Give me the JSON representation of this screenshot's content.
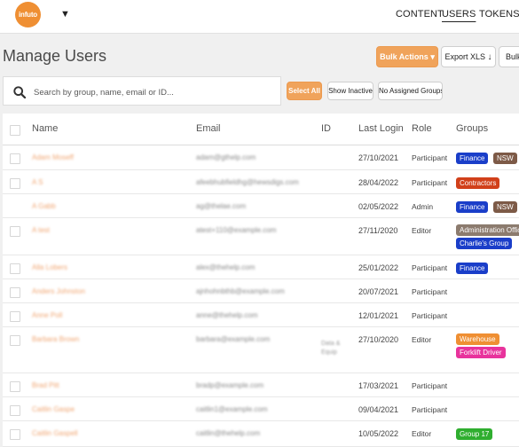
{
  "logo": {
    "text": "infuto"
  },
  "nav": {
    "content": "CONTENT",
    "users": "USERS",
    "tokens": "TOKENS"
  },
  "page": {
    "title": "Manage Users"
  },
  "toolbar": {
    "bulk_actions": "Bulk Actions ▾",
    "export_xls": "Export XLS",
    "bulk_cut": "Bulk"
  },
  "search": {
    "placeholder": "Search by group, name, email or ID..."
  },
  "filters": {
    "select_all": "Select All",
    "show_inactive": "Show Inactive",
    "no_assigned_groups": "No Assigned Groups"
  },
  "table": {
    "headers": {
      "name": "Name",
      "email": "Email",
      "id": "ID",
      "last_login": "Last Login",
      "role": "Role",
      "groups": "Groups"
    },
    "rows": [
      {
        "name": "Adam Moseff",
        "email": "adam@gthelp.com",
        "id": "",
        "last_login": "27/10/2021",
        "role": "Participant",
        "groups": [
          {
            "label": "Finance",
            "color": "#1a3ec9"
          },
          {
            "label": "NSW",
            "color": "#7d5a47"
          }
        ]
      },
      {
        "name": "A S",
        "email": "afeebhubfieldhg@hewsdigs.com",
        "id": "",
        "last_login": "28/04/2022",
        "role": "Participant",
        "groups": [
          {
            "label": "Contractors",
            "color": "#d1401a"
          }
        ]
      },
      {
        "name": "A Gabb",
        "email": "ag@thelae.com",
        "id": "",
        "last_login": "02/05/2022",
        "role": "Admin",
        "groups": [
          {
            "label": "Finance",
            "color": "#1a3ec9"
          },
          {
            "label": "NSW",
            "color": "#7d5a47"
          }
        ]
      },
      {
        "name": "A test",
        "email": "atest+110@example.com",
        "id": "",
        "last_login": "27/11/2020",
        "role": "Editor",
        "groups": [
          {
            "label": "Administration Office",
            "color": "#8c7b6e"
          },
          {
            "label": "Charlie's Group",
            "color": "#1a3ec9"
          }
        ]
      },
      {
        "name": "Alla Lobers",
        "email": "alex@thehelp.com",
        "id": "",
        "last_login": "25/01/2022",
        "role": "Participant",
        "groups": [
          {
            "label": "Finance",
            "color": "#1a3ec9"
          }
        ]
      },
      {
        "name": "Anders Johnston",
        "email": "ajnhohnbthb@example.com",
        "id": "",
        "last_login": "20/07/2021",
        "role": "Participant",
        "groups": []
      },
      {
        "name": "Anne Poll",
        "email": "anne@thehelp.com",
        "id": "",
        "last_login": "12/01/2021",
        "role": "Participant",
        "groups": []
      },
      {
        "name": "Barbara Brown",
        "email": "barbara@example.com",
        "id": "Data & Equip",
        "last_login": "27/10/2020",
        "role": "Editor",
        "groups": [
          {
            "label": "Warehouse",
            "color": "#ef8f33"
          },
          {
            "label": "Forklift Driver",
            "color": "#e8339c"
          }
        ]
      },
      {
        "name": "Brad Pitt",
        "email": "bradp@example.com",
        "id": "",
        "last_login": "17/03/2021",
        "role": "Participant",
        "groups": []
      },
      {
        "name": "Caitlin Gaspe",
        "email": "caitlin1@example.com",
        "id": "",
        "last_login": "09/04/2021",
        "role": "Participant",
        "groups": []
      },
      {
        "name": "Caitlin Gaspell",
        "email": "caitlin@thehelp.com",
        "id": "",
        "last_login": "10/05/2022",
        "role": "Editor",
        "groups": [
          {
            "label": "Group 17",
            "color": "#2fae2f"
          }
        ]
      }
    ]
  }
}
